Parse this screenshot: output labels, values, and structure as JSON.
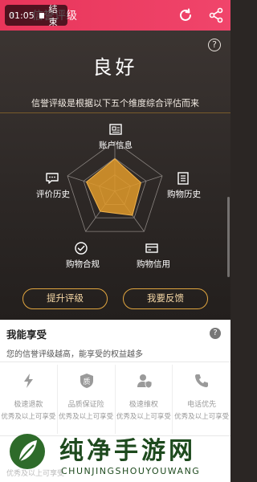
{
  "screen_recording": {
    "time": "01:05",
    "stop_label": "结束"
  },
  "navbar": {
    "title": "信誉评级",
    "bg": "#e8355a"
  },
  "rating": {
    "level": "良好",
    "description": "信誉评级是根据以下五个维度综合评估而来"
  },
  "dimensions": [
    {
      "label": "账户信息",
      "icon": "id-card-icon",
      "score": 0.65
    },
    {
      "label": "购物历史",
      "icon": "document-list-icon",
      "score": 0.55
    },
    {
      "label": "购物信用",
      "icon": "credit-card-icon",
      "score": 0.6
    },
    {
      "label": "购物合规",
      "icon": "check-circle-icon",
      "score": 0.5
    },
    {
      "label": "评价历史",
      "icon": "comment-icon",
      "score": 0.6
    }
  ],
  "actions": {
    "improve": "提升评级",
    "feedback": "我要反馈"
  },
  "benefits_section": {
    "title": "我能享受",
    "subtitle": "您的信誉评级越高，能享受的权益越多",
    "items": [
      {
        "name": "极速退款",
        "condition": "优秀及以上可享受",
        "icon": "lightning-icon"
      },
      {
        "name": "品质保证险",
        "condition": "优秀及以上可享受",
        "icon": "quality-shield-icon"
      },
      {
        "name": "极速维权",
        "condition": "优秀及以上可享受",
        "icon": "user-shield-icon"
      },
      {
        "name": "电话优先",
        "condition": "优秀及以上可享受",
        "icon": "phone-icon"
      }
    ],
    "second_row_partial": "优秀及以上可享受"
  },
  "watermark": {
    "title": "纯净手游网",
    "subtitle": "CHUNJINGSHOUYOUWANG"
  },
  "colors": {
    "accent_gold": "#e0a53f",
    "radar_fill": "#e09a2a",
    "panel_bg": "#2d2826"
  }
}
